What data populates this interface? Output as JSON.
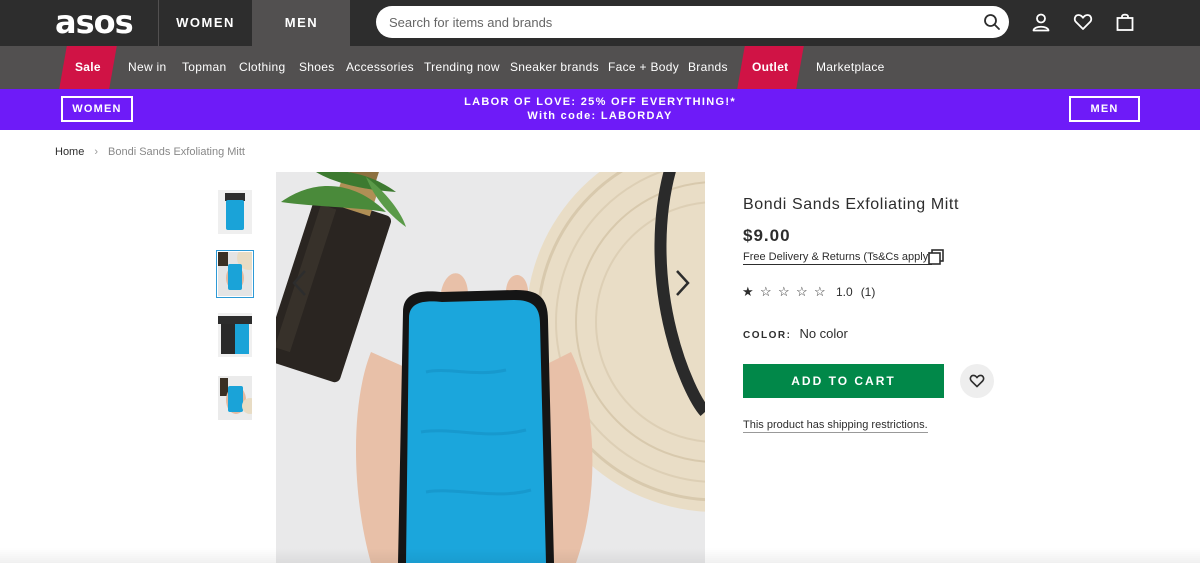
{
  "header": {
    "logo": "asos",
    "gender_tabs": [
      "WOMEN",
      "MEN"
    ],
    "search_placeholder": "Search for items and brands",
    "icons": [
      "search-icon",
      "account-icon",
      "heart-icon",
      "bag-icon"
    ]
  },
  "nav": {
    "items": [
      "Sale",
      "New in",
      "Topman",
      "Clothing",
      "Shoes",
      "Accessories",
      "Trending now",
      "Sneaker brands",
      "Face + Body",
      "Brands",
      "Outlet",
      "Marketplace"
    ],
    "highlight_color": "#d01345"
  },
  "promo": {
    "left_button": "WOMEN",
    "right_button": "MEN",
    "line1": "LABOR OF LOVE: 25% OFF EVERYTHING!*",
    "line2": "With code: LABORDAY",
    "background": "#6e1bf8"
  },
  "breadcrumb": {
    "home": "Home",
    "separator": "›",
    "current": "Bondi Sands Exfoliating Mitt"
  },
  "product": {
    "title": "Bondi Sands Exfoliating Mitt",
    "price": "$9.00",
    "delivery": "Free Delivery & Returns (Ts&Cs apply)",
    "rating_value": "1.0",
    "rating_count": "(1)",
    "rating_stars": 1,
    "color_label": "COLOR:",
    "color_value": "No color",
    "add_to_cart": "ADD TO CART",
    "shipping_note": "This product has shipping restrictions.",
    "button_color": "#018849"
  },
  "gallery": {
    "thumbnail_count": 4,
    "selected_index": 1
  }
}
